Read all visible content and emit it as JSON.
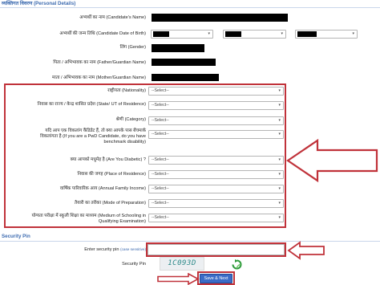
{
  "personal_details": {
    "heading": "व्यक्तिगत विवरण (Personal Details)",
    "fields": {
      "candidate_name": "अभ्यर्थी का नाम (Candidate's Name)",
      "dob": "अभ्यर्थी की जन्म तिथि (Candidate Date of Birth)",
      "gender": "लिंग (Gender)",
      "father_name": "पिता / अभिभावक का नाम (Father/Guardian Name)",
      "mother_name": "माता / अभिभावक का नाम (Mother/Guardian Name)",
      "nationality": "राष्ट्रीयता (Nationality)",
      "state": "निवास का राज्य / केन्द्र शासित प्रदेश (State/ UT of Residence)",
      "category": "श्रेणी (Category)",
      "pwd_line1": "यदि आप एक विकलांग कैंडिडेट हैं, तो क्या आपके पास बेंचमार्क",
      "pwd_line2": "विकलांगता है (If you are a PwD Candidate, do you have",
      "pwd_line3": "benchmark disability)",
      "diabetic": "क्या आपको मधुमेह है (Are You Diabetic) ?",
      "place": "निवास की जगह (Place of Residence)",
      "income": "वार्षिक पारिवारिक आय (Annual Family Income)",
      "prep": "तैयारी का तरीका (Mode of Preparation)",
      "medium_line1": "योग्यता परीक्षा में स्कूली शिक्षा का माध्यम (Medium of Schooling in",
      "medium_line2": "Qualifying Examination)"
    },
    "select_placeholder": "--Select--"
  },
  "security_pin": {
    "heading": "Security Pin",
    "enter_label": "Enter security pin",
    "case_note": "(case sensitive)",
    "pin_label": "Security Pin",
    "captcha_text": "1C093D"
  },
  "actions": {
    "save_next": "Save & Next"
  },
  "colors": {
    "annotation_red": "#c0323a",
    "heading_blue": "#3d6bb0",
    "button_blue": "#3b6cc7"
  }
}
